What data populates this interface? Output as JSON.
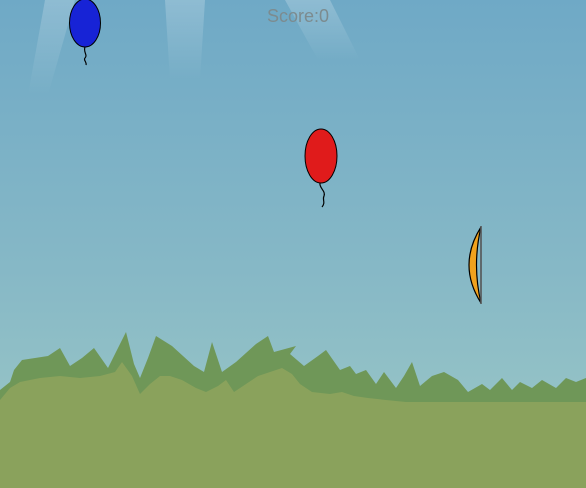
{
  "hud": {
    "score_label": "Score:",
    "score_value": "0"
  },
  "colors": {
    "sky_top": "#6fa9c6",
    "sky_bottom": "#9bc6c6",
    "grass_back": "#6f9758",
    "grass_front": "#8aa25c",
    "balloon_blue": "#1723d6",
    "balloon_red": "#e01b1b",
    "bow_wood": "#f0a21e",
    "bow_string": "#555555",
    "score_text": "#7c8b8f"
  },
  "entities": {
    "balloons": [
      {
        "id": "blue-balloon",
        "color": "blue"
      },
      {
        "id": "red-balloon",
        "color": "red"
      }
    ],
    "player": {
      "id": "bow",
      "icon": "bow-icon"
    }
  }
}
